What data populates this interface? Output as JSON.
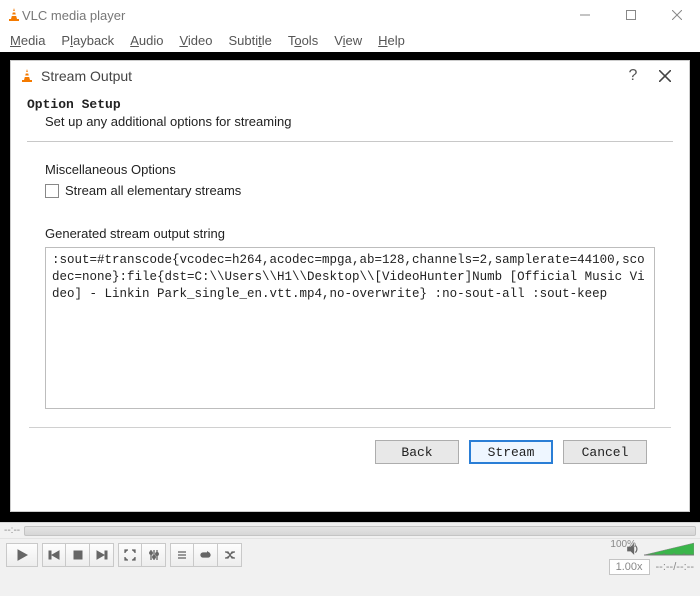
{
  "window": {
    "title": "VLC media player",
    "menus": [
      "Media",
      "Playback",
      "Audio",
      "Video",
      "Subtitle",
      "Tools",
      "View",
      "Help"
    ]
  },
  "dialog": {
    "title": "Stream Output",
    "section_title": "Option Setup",
    "section_sub": "Set up any additional options for streaming",
    "misc_header": "Miscellaneous Options",
    "checkbox_label": "Stream all elementary streams",
    "generated_header": "Generated stream output string",
    "generated_value": ":sout=#transcode{vcodec=h264,acodec=mpga,ab=128,channels=2,samplerate=44100,scodec=none}:file{dst=C:\\\\Users\\\\H1\\\\Desktop\\\\[VideoHunter]Numb [Official Music Video] - Linkin Park_single_en.vtt.mp4,no-overwrite} :no-sout-all :sout-keep",
    "buttons": {
      "back": "Back",
      "stream": "Stream",
      "cancel": "Cancel"
    }
  },
  "player": {
    "seek_left": "--:--",
    "rate": "1.00x",
    "time": "--:--/--:--",
    "volume_pct": "100%"
  }
}
